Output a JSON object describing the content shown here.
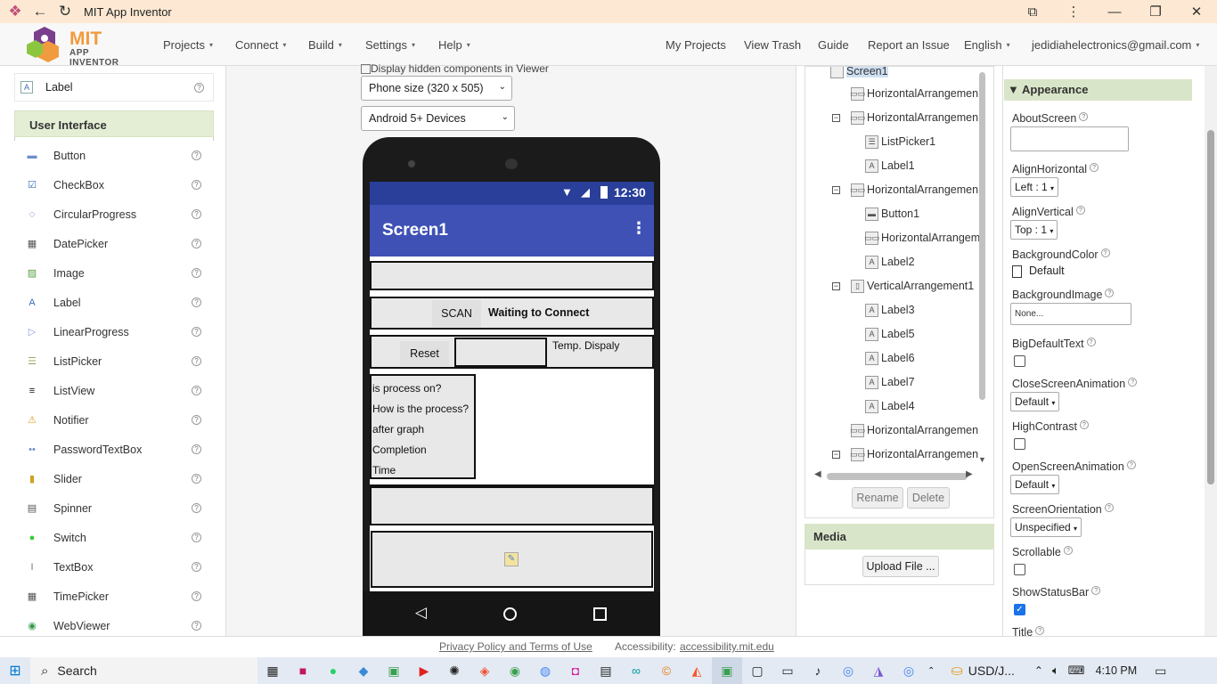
{
  "window": {
    "title": "MIT App Inventor"
  },
  "header": {
    "logo_mit": "MIT",
    "logo_sub": "APP INVENTOR",
    "menus": [
      "Projects",
      "Connect",
      "Build",
      "Settings",
      "Help"
    ],
    "right_links": [
      "My Projects",
      "View Trash",
      "Guide",
      "Report an Issue"
    ],
    "language": "English",
    "account": "jedidiahelectronics@gmail.com"
  },
  "palette": {
    "top_item": "Label",
    "section": "User Interface",
    "items": [
      {
        "label": "Button",
        "icon": "button-icon",
        "color": "#6c8fc7"
      },
      {
        "label": "CheckBox",
        "icon": "checkbox-icon",
        "color": "#3a6fb8"
      },
      {
        "label": "CircularProgress",
        "icon": "circular-progress-icon",
        "color": "#3a4fb8"
      },
      {
        "label": "DatePicker",
        "icon": "datepicker-icon",
        "color": "#555555"
      },
      {
        "label": "Image",
        "icon": "image-icon",
        "color": "#5aa04a"
      },
      {
        "label": "Label",
        "icon": "label-icon",
        "color": "#3a6fb8"
      },
      {
        "label": "LinearProgress",
        "icon": "linear-progress-icon",
        "color": "#8a9ad8"
      },
      {
        "label": "ListPicker",
        "icon": "listpicker-icon",
        "color": "#9aa860"
      },
      {
        "label": "ListView",
        "icon": "listview-icon",
        "color": "#111111"
      },
      {
        "label": "Notifier",
        "icon": "notifier-icon",
        "color": "#e0a020"
      },
      {
        "label": "PasswordTextBox",
        "icon": "password-textbox-icon",
        "color": "#6c8fc7"
      },
      {
        "label": "Slider",
        "icon": "slider-icon",
        "color": "#d0a020"
      },
      {
        "label": "Spinner",
        "icon": "spinner-icon",
        "color": "#555555"
      },
      {
        "label": "Switch",
        "icon": "switch-icon",
        "color": "#33cc33"
      },
      {
        "label": "TextBox",
        "icon": "textbox-icon",
        "color": "#777777"
      },
      {
        "label": "TimePicker",
        "icon": "timepicker-icon",
        "color": "#555555"
      },
      {
        "label": "WebViewer",
        "icon": "webviewer-icon",
        "color": "#3a9a4a"
      }
    ]
  },
  "viewer": {
    "hidden_checkbox_label": "Display hidden components in Viewer",
    "size_select": "Phone size (320 x 505)",
    "device_select": "Android 5+ Devices",
    "status_time": "12:30",
    "screen_title": "Screen1",
    "scan_button": "SCAN",
    "waiting_label": "Waiting to Connect",
    "reset_button": "Reset",
    "temp_label": "Temp. Dispaly",
    "list_labels": [
      "is process on?",
      "How is the process?",
      "after graph",
      "Completion",
      "Time"
    ]
  },
  "components": {
    "root": "Screen1",
    "nodes": [
      {
        "label": "HorizontalArrangemen",
        "icon": "arrangement-icon"
      },
      {
        "label": "HorizontalArrangemen",
        "icon": "arrangement-icon"
      },
      {
        "label": "ListPicker1",
        "icon": "listpicker-icon"
      },
      {
        "label": "Label1",
        "icon": "label-icon"
      },
      {
        "label": "HorizontalArrangemen",
        "icon": "arrangement-icon"
      },
      {
        "label": "Button1",
        "icon": "button-icon"
      },
      {
        "label": "HorizontalArrangem",
        "icon": "arrangement-icon"
      },
      {
        "label": "Label2",
        "icon": "label-icon"
      },
      {
        "label": "VerticalArrangement1",
        "icon": "vertical-arrangement-icon"
      },
      {
        "label": "Label3",
        "icon": "label-icon"
      },
      {
        "label": "Label5",
        "icon": "label-icon"
      },
      {
        "label": "Label6",
        "icon": "label-icon"
      },
      {
        "label": "Label7",
        "icon": "label-icon"
      },
      {
        "label": "Label4",
        "icon": "label-icon"
      },
      {
        "label": "HorizontalArrangemen",
        "icon": "arrangement-icon"
      },
      {
        "label": "HorizontalArrangemen",
        "icon": "arrangement-icon"
      }
    ],
    "rename": "Rename",
    "delete": "Delete"
  },
  "media": {
    "title": "Media",
    "upload": "Upload File ..."
  },
  "properties": {
    "section": "Appearance",
    "about_screen": "AboutScreen",
    "align_horizontal": "AlignHorizontal",
    "align_horizontal_value": "Left : 1",
    "align_vertical": "AlignVertical",
    "align_vertical_value": "Top : 1",
    "background_color": "BackgroundColor",
    "background_color_value": "Default",
    "background_image": "BackgroundImage",
    "background_image_value": "None...",
    "big_default_text": "BigDefaultText",
    "close_screen_animation": "CloseScreenAnimation",
    "close_screen_animation_value": "Default",
    "high_contrast": "HighContrast",
    "open_screen_animation": "OpenScreenAnimation",
    "open_screen_animation_value": "Default",
    "screen_orientation": "ScreenOrientation",
    "screen_orientation_value": "Unspecified",
    "scrollable": "Scrollable",
    "show_status_bar": "ShowStatusBar",
    "title": "Title"
  },
  "footer": {
    "privacy": "Privacy Policy and Terms of Use",
    "accessibility_label": "Accessibility:",
    "accessibility_link": "accessibility.mit.edu"
  },
  "taskbar": {
    "search": "Search",
    "currency": "USD/J...",
    "time": "4:10 PM"
  }
}
